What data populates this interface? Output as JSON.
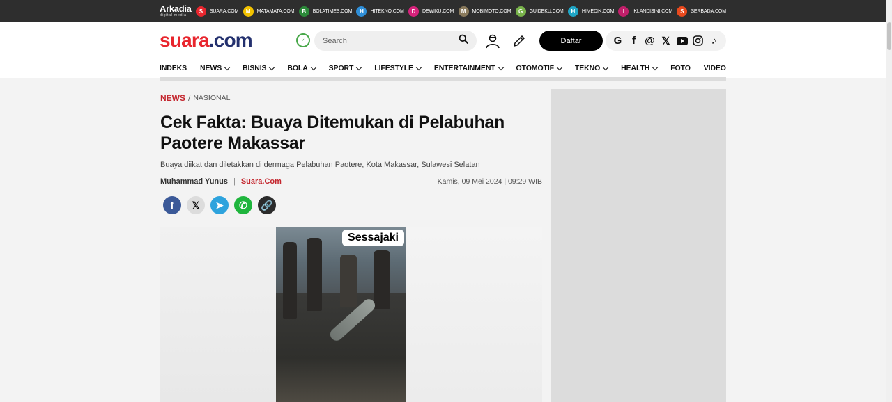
{
  "network": {
    "brand_main": "Arkadia",
    "brand_sub": "digital media",
    "items": [
      {
        "label": "SUARA.COM",
        "glyph": "S",
        "color": "#e8262e"
      },
      {
        "label": "MATAMATA.COM",
        "glyph": "M",
        "color": "#f2c200"
      },
      {
        "label": "BOLATIMES.COM",
        "glyph": "B",
        "color": "#2c8a3a"
      },
      {
        "label": "HITEKNO.COM",
        "glyph": "H",
        "color": "#2f8fd8"
      },
      {
        "label": "DEWIKU.COM",
        "glyph": "D",
        "color": "#d6227b"
      },
      {
        "label": "MOBIMOTO.COM",
        "glyph": "M",
        "color": "#8a7a5c"
      },
      {
        "label": "GUIDEKU.COM",
        "glyph": "G",
        "color": "#78b24a"
      },
      {
        "label": "HIMEDIK.COM",
        "glyph": "H",
        "color": "#20a6c6"
      },
      {
        "label": "IKLANDISINI.COM",
        "glyph": "I",
        "color": "#c11f6a"
      },
      {
        "label": "SERBADA.COM",
        "glyph": "S",
        "color": "#e94a1e"
      }
    ]
  },
  "header": {
    "logo_main": "suara",
    "logo_ext": ".com",
    "search_placeholder": "Search",
    "register_label": "Daftar"
  },
  "nav": [
    {
      "label": "INDEKS",
      "dropdown": false
    },
    {
      "label": "NEWS",
      "dropdown": true
    },
    {
      "label": "BISNIS",
      "dropdown": true
    },
    {
      "label": "BOLA",
      "dropdown": true
    },
    {
      "label": "SPORT",
      "dropdown": true
    },
    {
      "label": "LIFESTYLE",
      "dropdown": true
    },
    {
      "label": "ENTERTAINMENT",
      "dropdown": true
    },
    {
      "label": "OTOMOTIF",
      "dropdown": true
    },
    {
      "label": "TEKNO",
      "dropdown": true
    },
    {
      "label": "HEALTH",
      "dropdown": true
    },
    {
      "label": "FOTO",
      "dropdown": false
    },
    {
      "label": "VIDEO",
      "dropdown": false
    }
  ],
  "article": {
    "section": "NEWS",
    "separator": "/",
    "category": "NASIONAL",
    "title": "Cek Fakta: Buaya Ditemukan di Pelabuhan Paotere Makassar",
    "summary": "Buaya diikat dan diletakkan di dermaga Pelabuhan Paotere, Kota Makassar, Sulawesi Selatan",
    "author": "Muhammad Yunus",
    "author_separator": "|",
    "source": "Suara.Com",
    "date": "Kamis, 09 Mei 2024 | 09:29 WIB",
    "image_caption_tag": "Sessajaki"
  },
  "share": [
    {
      "name": "facebook",
      "glyph": "f",
      "color": "#3b5998"
    },
    {
      "name": "x",
      "glyph": "𝕏",
      "color": "#dcdcdc"
    },
    {
      "name": "telegram",
      "glyph": "➤",
      "color": "#2ea3dd"
    },
    {
      "name": "whatsapp",
      "glyph": "✆",
      "color": "#1fb53d"
    },
    {
      "name": "copy-link",
      "glyph": "🔗",
      "color": "#2b2b2b"
    }
  ],
  "colors": {
    "brand_red": "#e8262e",
    "brand_navy": "#23306e",
    "accent_red": "#c4262e"
  }
}
